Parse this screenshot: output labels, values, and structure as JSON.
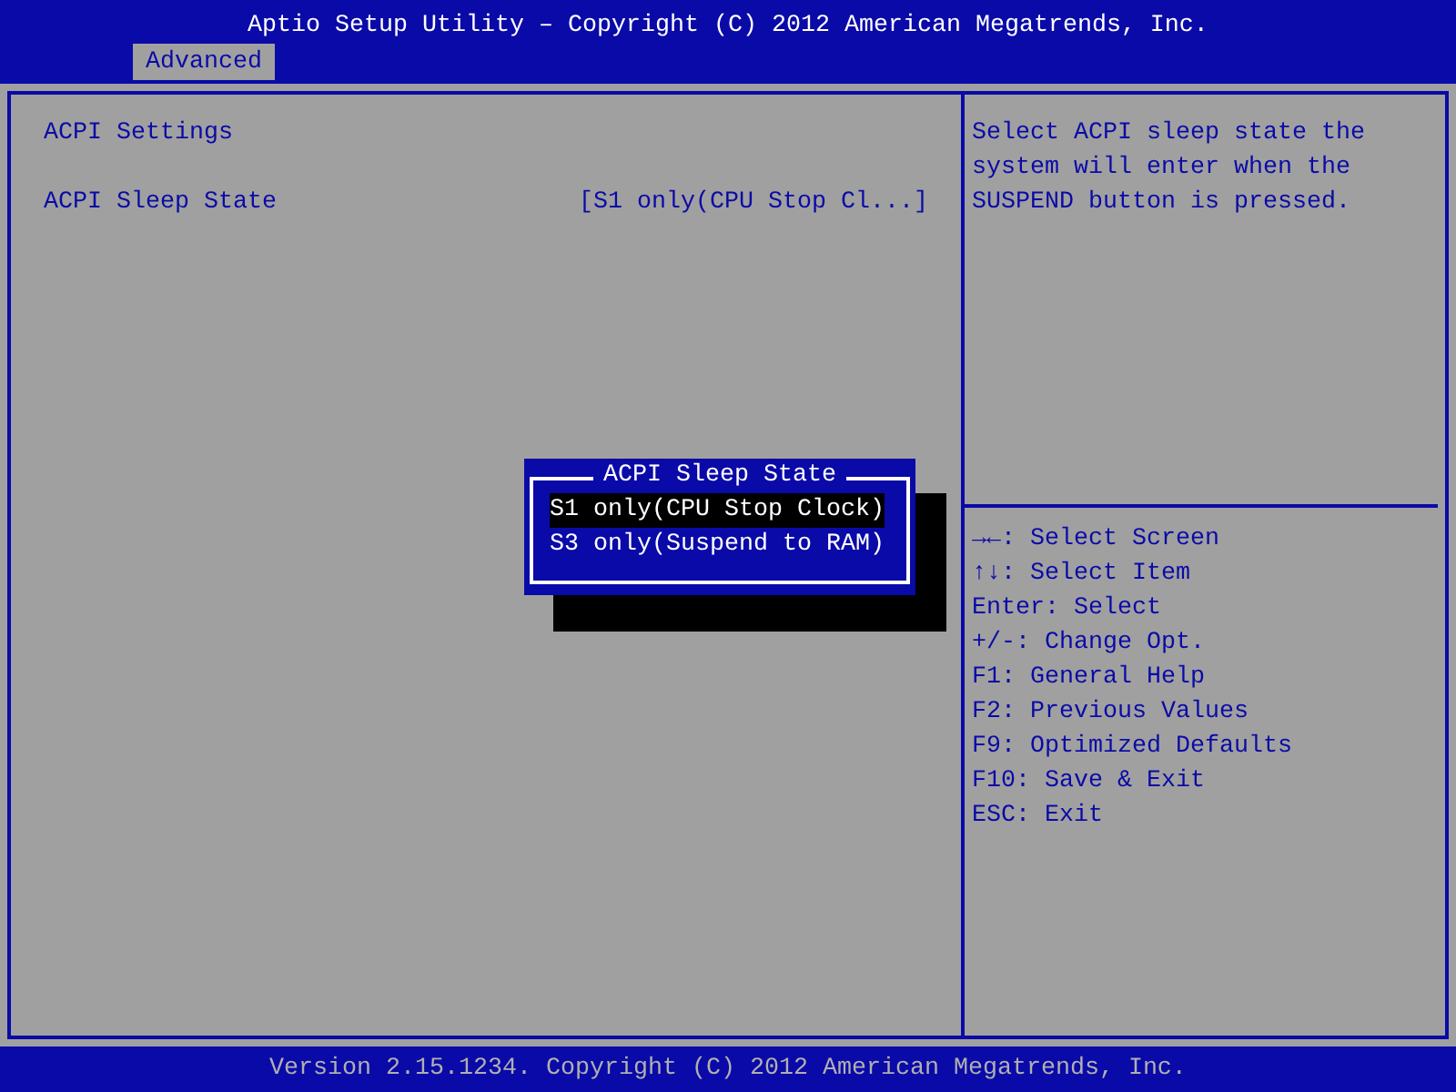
{
  "header": {
    "title": "Aptio Setup Utility – Copyright (C) 2012 American Megatrends, Inc.",
    "tabs": [
      {
        "label": "Advanced",
        "selected": true
      }
    ]
  },
  "settings": [
    {
      "kind": "heading",
      "label": "ACPI Settings"
    },
    {
      "kind": "option",
      "label": "ACPI Sleep State",
      "value": "[S1 only(CPU Stop Cl...]"
    }
  ],
  "help_text": "Select ACPI sleep state the system will enter when the SUSPEND button is pressed.",
  "key_help": [
    "→←: Select Screen",
    "↑↓: Select Item",
    "Enter: Select",
    "+/-: Change Opt.",
    "F1: General Help",
    "F2: Previous Values",
    "F9: Optimized Defaults",
    "F10: Save & Exit",
    "ESC: Exit"
  ],
  "popup": {
    "title": "ACPI Sleep State",
    "options": [
      {
        "label": "S1 only(CPU Stop Clock)",
        "selected": true
      },
      {
        "label": "S3 only(Suspend to RAM)",
        "selected": false
      }
    ]
  },
  "footer": "Version 2.15.1234. Copyright (C) 2012 American Megatrends, Inc."
}
